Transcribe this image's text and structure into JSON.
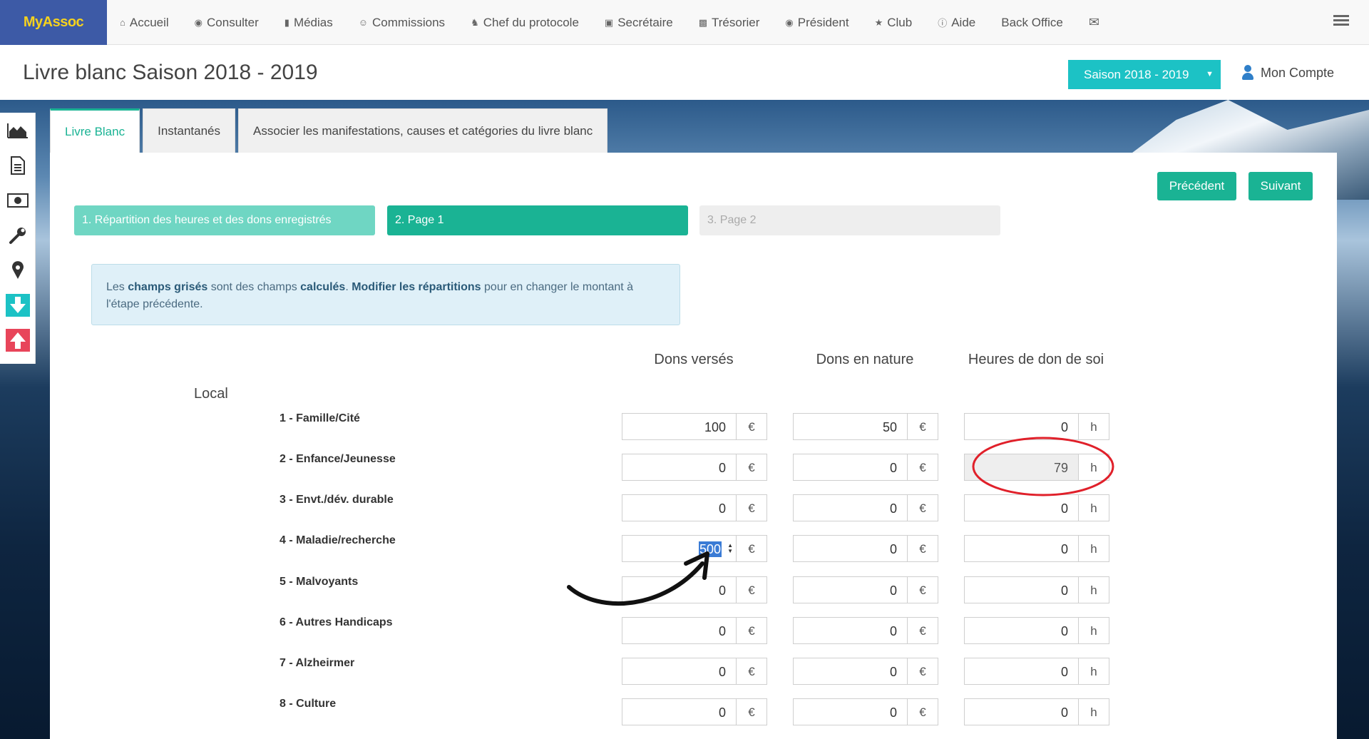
{
  "navbar": {
    "brand": "MyAssoc",
    "items": [
      {
        "label": "Accueil",
        "icon": "home-icon"
      },
      {
        "label": "Consulter",
        "icon": "eye-icon"
      },
      {
        "label": "Médias",
        "icon": "file-icon"
      },
      {
        "label": "Commissions",
        "icon": "user-circle-icon"
      },
      {
        "label": "Chef du protocole",
        "icon": "trophy-icon"
      },
      {
        "label": "Secrétaire",
        "icon": "book-icon"
      },
      {
        "label": "Trésorier",
        "icon": "money-icon"
      },
      {
        "label": "Président",
        "icon": "globe-icon"
      },
      {
        "label": "Club",
        "icon": "star-icon"
      },
      {
        "label": "Aide",
        "icon": "info-icon"
      },
      {
        "label": "Back Office",
        "icon": ""
      }
    ],
    "mail_icon": "envelope-icon",
    "menu_icon": "hamburger-icon"
  },
  "header": {
    "title": "Livre blanc Saison 2018 - 2019",
    "season_selector": "Saison 2018 - 2019",
    "account": "Mon Compte"
  },
  "sidebar": {
    "icons": [
      "area-chart-icon",
      "document-icon",
      "money-icon",
      "wrench-icon",
      "map-marker-icon",
      "download-icon",
      "upload-icon"
    ]
  },
  "tabs": [
    {
      "label": "Livre Blanc",
      "active": true
    },
    {
      "label": "Instantanés",
      "active": false
    },
    {
      "label": "Associer les manifestations, causes et catégories du livre blanc",
      "active": false
    }
  ],
  "nav_buttons": {
    "prev": "Précédent",
    "next": "Suivant"
  },
  "steps": [
    {
      "label": "1. Répartition des heures et des dons enregistrés",
      "state": "done"
    },
    {
      "label": "2. Page 1",
      "state": "current"
    },
    {
      "label": "3. Page 2",
      "state": "disabled"
    }
  ],
  "info": {
    "p1": "Les ",
    "b1": "champs grisés",
    "p2": " sont des champs ",
    "b2": "calculés",
    "p3": ". ",
    "b3": "Modifier les répartitions",
    "p4": " pour en changer le montant à l'étape précédente."
  },
  "columns": {
    "dons_verses": "Dons versés",
    "dons_nature": "Dons en nature",
    "heures": "Heures de don de soi"
  },
  "units": {
    "euro": "€",
    "hour": "h"
  },
  "section": "Local",
  "rows": [
    {
      "label": "1 - Famille/Cité",
      "dons": "100",
      "nature": "50",
      "heures": "0"
    },
    {
      "label": "2 - Enfance/Jeunesse",
      "dons": "0",
      "nature": "0",
      "heures": "79"
    },
    {
      "label": "3 - Envt./dév. durable",
      "dons": "0",
      "nature": "0",
      "heures": "0"
    },
    {
      "label": "4 - Maladie/recherche",
      "dons": "500",
      "nature": "0",
      "heures": "0"
    },
    {
      "label": "5 - Malvoyants",
      "dons": "0",
      "nature": "0",
      "heures": "0"
    },
    {
      "label": "6 - Autres Handicaps",
      "dons": "0",
      "nature": "0",
      "heures": "0"
    },
    {
      "label": "7 - Alzheirmer",
      "dons": "0",
      "nature": "0",
      "heures": "0"
    },
    {
      "label": "8 - Culture",
      "dons": "0",
      "nature": "0",
      "heures": "0"
    }
  ],
  "colors": {
    "brand_bg": "#3d5aa6",
    "brand_text": "#f6d21e",
    "accent": "#1ab394",
    "season": "#1cc2c5",
    "annotation": "#e0202a"
  }
}
